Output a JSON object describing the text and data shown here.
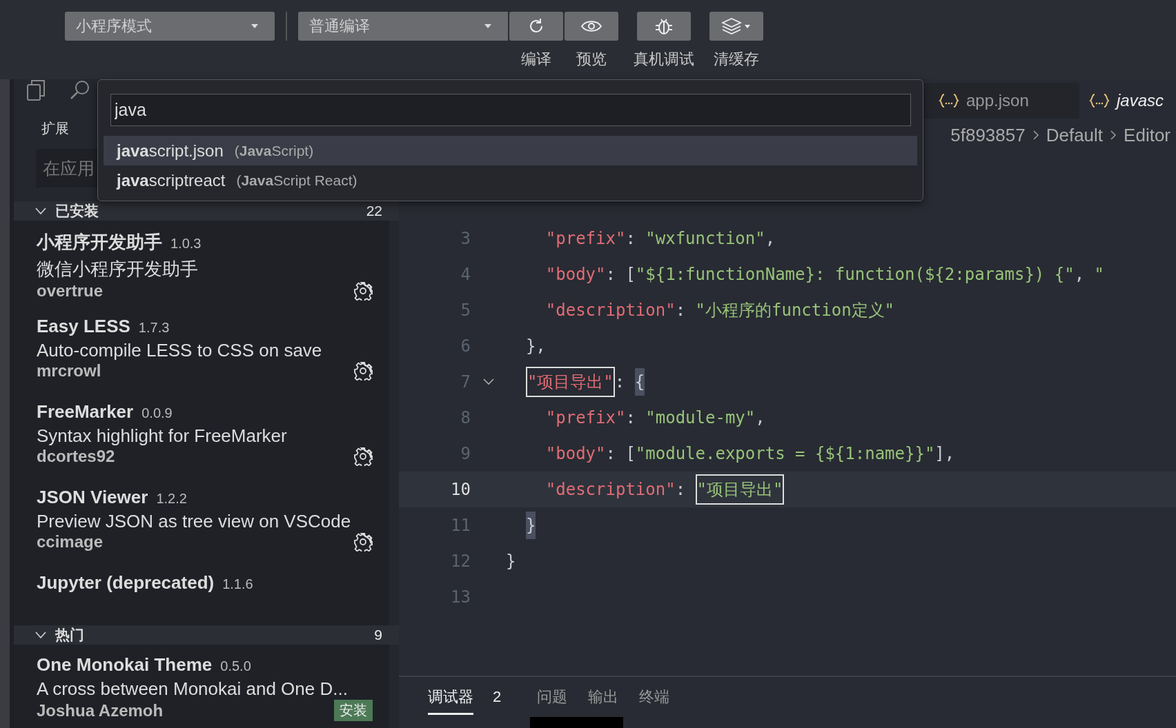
{
  "toolbar": {
    "mode_dropdown": "小程序模式",
    "compile_dropdown": "普通编译",
    "buttons": [
      {
        "kind": "compile",
        "label": "编译"
      },
      {
        "kind": "preview",
        "label": "预览"
      },
      {
        "kind": "debug",
        "label": "真机调试"
      },
      {
        "kind": "cache",
        "label": "清缓存"
      }
    ]
  },
  "sidebar": {
    "title": "扩展",
    "search": {
      "placeholder": "在应用"
    },
    "sections": [
      {
        "title": "已安装",
        "count": "22",
        "expanded": true,
        "items": [
          {
            "kind": "installed",
            "name": "小程序开发助手",
            "version": "1.0.3",
            "description": "微信小程序开发助手",
            "author": "overtrue"
          },
          {
            "kind": "installed",
            "name": "Easy LESS",
            "version": "1.7.3",
            "description": "Auto-compile LESS to CSS on save",
            "author": "mrcrowl"
          },
          {
            "kind": "installed",
            "name": "FreeMarker",
            "version": "0.0.9",
            "description": "Syntax highlight for FreeMarker",
            "author": "dcortes92"
          },
          {
            "kind": "installed",
            "name": "JSON Viewer",
            "version": "1.2.2",
            "description": "Preview JSON as tree view on VSCode",
            "author": "ccimage"
          },
          {
            "name": "Jupyter (deprecated)",
            "version": "1.1.6"
          }
        ]
      },
      {
        "title": "热门",
        "count": "9",
        "expanded": true,
        "items": [
          {
            "kind": "available",
            "name": "One Monokai Theme",
            "version": "0.5.0",
            "description": "A cross between Monokai and One D...",
            "author": "Joshua Azemoh",
            "install_label": "安装"
          }
        ]
      }
    ]
  },
  "editor": {
    "tabs": [
      {
        "label": "app.json",
        "selected": false
      },
      {
        "label": "javasc",
        "selected": true
      }
    ],
    "breadcrumb": [
      "5f893857",
      "Default",
      "Editor"
    ],
    "lines": [
      {
        "number": "3",
        "current": false,
        "tokens": [
          {
            "kind": "key",
            "text": "    \"prefix\""
          },
          {
            "kind": "punct",
            "text": ": "
          },
          {
            "kind": "string",
            "text": "\"wxfunction\""
          },
          {
            "kind": "punct",
            "text": ","
          }
        ]
      },
      {
        "number": "4",
        "current": false,
        "tokens": [
          {
            "kind": "key",
            "text": "    \"body\""
          },
          {
            "kind": "punct",
            "text": ": ["
          },
          {
            "kind": "string",
            "text": "\"${1:functionName}: function(${2:params}) {\""
          },
          {
            "kind": "punct",
            "text": ", "
          },
          {
            "kind": "string",
            "text": "\""
          }
        ]
      },
      {
        "number": "5",
        "current": false,
        "tokens": [
          {
            "kind": "key",
            "text": "    \"description\""
          },
          {
            "kind": "punct",
            "text": ": "
          },
          {
            "kind": "string",
            "text": "\"小程序的function定义\""
          }
        ]
      },
      {
        "number": "6",
        "current": false,
        "tokens": [
          {
            "kind": "punct",
            "text": "  },"
          }
        ]
      },
      {
        "number": "7",
        "current": false,
        "foldable": true,
        "tokens": [
          {
            "kind": "key",
            "text": "  \"项目导出\"",
            "boxed": true
          },
          {
            "kind": "punct",
            "text": ": "
          },
          {
            "kind": "punct",
            "text": "{",
            "bracket_match": true
          }
        ]
      },
      {
        "number": "8",
        "current": false,
        "tokens": [
          {
            "kind": "key",
            "text": "    \"prefix\""
          },
          {
            "kind": "punct",
            "text": ": "
          },
          {
            "kind": "string",
            "text": "\"module-my\""
          },
          {
            "kind": "punct",
            "text": ","
          }
        ]
      },
      {
        "number": "9",
        "current": false,
        "tokens": [
          {
            "kind": "key",
            "text": "    \"body\""
          },
          {
            "kind": "punct",
            "text": ": ["
          },
          {
            "kind": "string",
            "text": "\"module.exports = {${1:name}}\""
          },
          {
            "kind": "punct",
            "text": "],"
          }
        ]
      },
      {
        "number": "10",
        "current": true,
        "tokens": [
          {
            "kind": "key",
            "text": "    \"description\""
          },
          {
            "kind": "punct",
            "text": ": "
          },
          {
            "kind": "string",
            "text": "\"项目导出\"",
            "boxed": true
          }
        ]
      },
      {
        "number": "11",
        "current": false,
        "tokens": [
          {
            "kind": "punct",
            "text": "  }",
            "bracket_match": true
          }
        ]
      },
      {
        "number": "12",
        "current": false,
        "tokens": [
          {
            "kind": "punct",
            "text": "}"
          }
        ]
      },
      {
        "number": "13",
        "current": false
      }
    ]
  },
  "quick_pick": {
    "value": "java",
    "items": [
      {
        "label": "**java**script.json",
        "detail": "(**Java**Script)",
        "selected": true
      },
      {
        "label": "**java**scriptreact",
        "detail": "(**Java**Script React)",
        "selected": false
      }
    ]
  },
  "panel": {
    "tabs": [
      {
        "label": "调试器",
        "badge": "2",
        "selected": true
      },
      {
        "label": "问题",
        "selected": false
      },
      {
        "label": "输出",
        "selected": false
      },
      {
        "label": "终端",
        "selected": false
      }
    ]
  }
}
